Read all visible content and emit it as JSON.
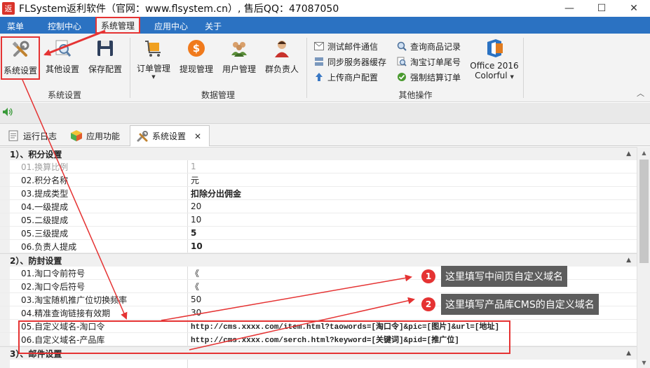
{
  "window": {
    "title": "FLSystem返利软件（官网：www.flsystem.cn）, 售后QQ：47087050",
    "app_icon_text": "返",
    "minimize": "—",
    "maximize": "☐",
    "close": "✕"
  },
  "menu": {
    "tabs": [
      "菜单",
      "控制中心",
      "系统管理",
      "应用中心",
      "关于"
    ],
    "active": "系统管理"
  },
  "ribbon": {
    "groups": [
      {
        "name": "系统设置",
        "buttons": [
          "系统设置",
          "其他设置",
          "保存配置"
        ]
      },
      {
        "name": "数据管理",
        "buttons": [
          "订单管理",
          "提现管理",
          "用户管理",
          "群负责人"
        ]
      },
      {
        "name": "其他操作",
        "buttons": [
          "测试邮件通信",
          "同步服务器缓存",
          "上传商户配置",
          "查询商品记录",
          "淘宝订单尾号",
          "强制结算订单",
          "Office 2016 Colorful"
        ]
      }
    ],
    "office_theme_line1": "Office 2016",
    "office_theme_line2": "Colorful"
  },
  "doc_tabs": [
    "运行日志",
    "应用功能",
    "系统设置"
  ],
  "close_tab_glyph": "✕",
  "property_grid": {
    "sections": [
      {
        "title": "1）、积分设置",
        "rows": [
          {
            "name": "01.换算比例",
            "value": "1",
            "disabled": true
          },
          {
            "name": "02.积分名称",
            "value": "元"
          },
          {
            "name": "03.提成类型",
            "value": "扣除分出佣金",
            "bold": true
          },
          {
            "name": "04.一级提成",
            "value": "20"
          },
          {
            "name": "05.二级提成",
            "value": "10"
          },
          {
            "name": "05.三级提成",
            "value": "5",
            "bold": true
          },
          {
            "name": "06.负责人提成",
            "value": "10",
            "bold": true
          }
        ]
      },
      {
        "title": "2）、防封设置",
        "rows": [
          {
            "name": "01.淘口令前符号",
            "value": "《"
          },
          {
            "name": "02.淘口令后符号",
            "value": "《"
          },
          {
            "name": "03.淘宝随机推广位切换频率",
            "value": "50"
          },
          {
            "name": "04.精准查询链接有效期",
            "value": "30"
          },
          {
            "name": "05.自定义域名-淘口令",
            "value": "http://cms.xxxx.com/item.html?taowords=[淘口令]&pic=[图片]&url=[地址]",
            "url": true
          },
          {
            "name": "06.自定义域名-产品库",
            "value": "http://cms.xxxx.com/serch.html?keyword=[关键词]&pid=[推广位]",
            "url": true
          }
        ]
      },
      {
        "title": "3）、邮件设置",
        "rows": []
      }
    ]
  },
  "annotations": [
    {
      "number": "1",
      "text": "这里填写中间页自定义域名"
    },
    {
      "number": "2",
      "text": "这里填写产品库CMS的自定义域名"
    }
  ],
  "colors": {
    "menu_bar": "#2b72c2",
    "highlight_red": "#e53333",
    "annotation_bg": "#5d5d5d"
  }
}
